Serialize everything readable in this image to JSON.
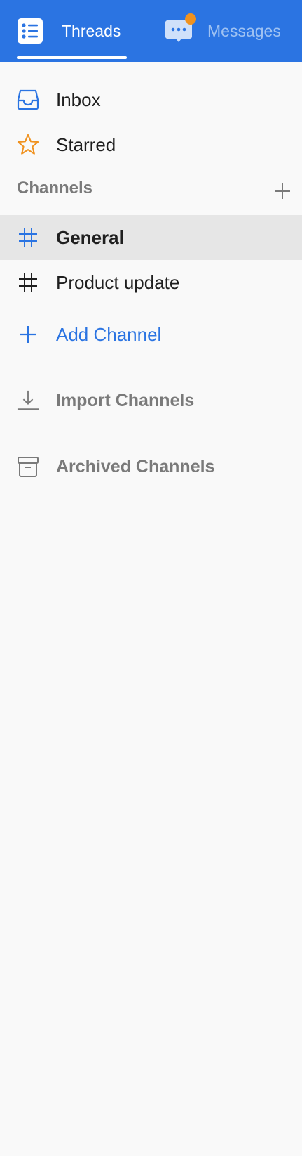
{
  "header": {
    "tabs": [
      {
        "label": "Threads",
        "icon": "list-icon",
        "active": true
      },
      {
        "label": "Messages",
        "icon": "chat-bubble-icon",
        "active": false,
        "has_notification": true
      }
    ],
    "notification_color": "#f0921f",
    "brand_color": "#2b74e2"
  },
  "nav": {
    "inbox": {
      "label": "Inbox",
      "icon": "inbox-tray-icon"
    },
    "starred": {
      "label": "Starred",
      "icon": "star-icon"
    }
  },
  "channels": {
    "title": "Channels",
    "add_icon": "plus-icon",
    "items": [
      {
        "label": "General",
        "icon": "hash-icon",
        "selected": true
      },
      {
        "label": "Product update",
        "icon": "hash-icon",
        "selected": false
      }
    ],
    "add_channel": {
      "label": "Add Channel",
      "icon": "plus-icon"
    },
    "import_channels": {
      "label": "Import Channels",
      "icon": "download-icon"
    },
    "archived_channels": {
      "label": "Archived Channels",
      "icon": "archive-box-icon"
    }
  }
}
